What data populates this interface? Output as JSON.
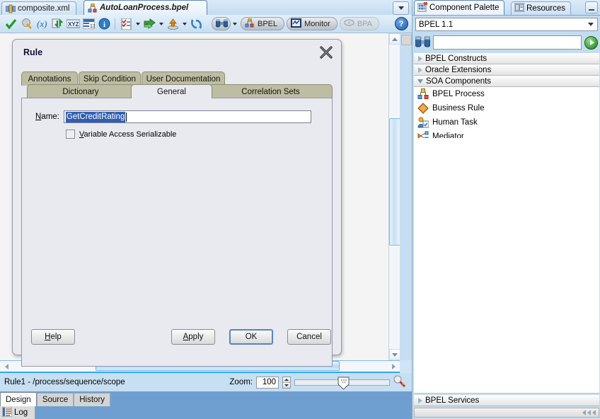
{
  "editor": {
    "tabs": [
      {
        "label": "composite.xml",
        "icon": "composite-icon",
        "active": false
      },
      {
        "label": "AutoLoanProcess.bpel",
        "icon": "bpel-process-icon",
        "active": true
      }
    ],
    "tabstrip_menu_icon": "chevron-down-icon",
    "toolbar": {
      "icons": [
        "validate-check-icon",
        "refresh-icon",
        "variables-xy-icon",
        "import-export-icon",
        "xyz-text-icon",
        "generate-table-icon",
        "info-icon"
      ],
      "split_icons": [
        "checklist-icon",
        "green-arrows-icon",
        "deploy-icon"
      ],
      "last_icon": "recycle-icon",
      "binoculars_icon": "binoculars-icon",
      "modes": [
        {
          "label": "BPEL",
          "icon": "bpel-icon",
          "active": true,
          "enabled": true
        },
        {
          "label": "Monitor",
          "icon": "monitor-icon",
          "active": false,
          "enabled": true
        },
        {
          "label": "BPA",
          "icon": "bpa-icon",
          "active": false,
          "enabled": false
        }
      ],
      "help_label": "?"
    },
    "statusbar": {
      "path": "Rule1 - /process/sequence/scope",
      "zoom_label": "Zoom:",
      "zoom_value": "100",
      "magnifier_icon": "magnifier-icon"
    },
    "bottom_tabs": [
      {
        "label": "Design",
        "selected": true
      },
      {
        "label": "Source",
        "selected": false
      },
      {
        "label": "History",
        "selected": false
      }
    ],
    "log": {
      "label": "Log",
      "icon": "log-icon"
    }
  },
  "dialog": {
    "title": "Rule",
    "close_icon": "close-icon",
    "tabs_row1": [
      {
        "label": "Annotations",
        "selected": false
      },
      {
        "label": "Skip Condition",
        "selected": false
      },
      {
        "label": "User Documentation",
        "selected": false
      }
    ],
    "tabs_row2": [
      {
        "label": "Dictionary",
        "selected": false
      },
      {
        "label": "General",
        "selected": true
      },
      {
        "label": "Correlation Sets",
        "selected": false
      }
    ],
    "name_label": "Name:",
    "name_value": "GetCreditRating",
    "checkbox_label": "Variable Access Serializable",
    "checkbox_checked": false,
    "buttons": {
      "help": "Help",
      "apply": "Apply",
      "ok": "OK",
      "cancel": "Cancel"
    }
  },
  "palette": {
    "tabs": [
      {
        "label": "Component Palette",
        "icon": "palette-grid-icon",
        "selected": true
      },
      {
        "label": "Resources",
        "icon": "resources-book-icon",
        "selected": false
      }
    ],
    "minimize_icon": "minimize-icon",
    "selector_value": "BPEL 1.1",
    "selector_arrow_icon": "chevron-down-icon",
    "search_icon": "binoculars-icon",
    "search_value": "",
    "go_icon": "go-arrow-icon",
    "groups": [
      {
        "label": "BPEL Constructs",
        "expanded": false,
        "items": []
      },
      {
        "label": "Oracle Extensions",
        "expanded": false,
        "items": []
      },
      {
        "label": "SOA Components",
        "expanded": true,
        "items": [
          {
            "label": "BPEL Process",
            "icon": "bpel-process-icon"
          },
          {
            "label": "Business Rule",
            "icon": "business-rule-icon"
          },
          {
            "label": "Human Task",
            "icon": "human-task-icon"
          },
          {
            "label": "Mediator",
            "icon": "mediator-icon"
          }
        ]
      }
    ],
    "services_group": {
      "label": "BPEL Services",
      "expanded": false
    }
  }
}
